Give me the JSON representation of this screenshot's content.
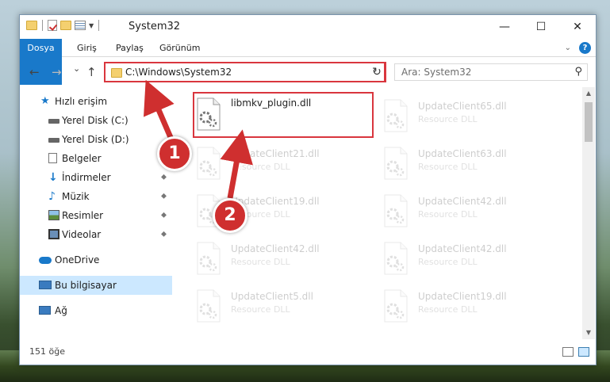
{
  "window": {
    "title": "System32",
    "buttons": {
      "minimize": "—",
      "maximize": "☐",
      "close": "✕"
    }
  },
  "ribbon": {
    "tabs": [
      "Dosya",
      "Giriş",
      "Paylaş",
      "Görünüm"
    ],
    "expand_icon": "chevron-down-icon",
    "help": "?"
  },
  "nav": {
    "back": "←",
    "forward": "→",
    "recent": "⌄",
    "up": "↑"
  },
  "address": {
    "path": "C:\\Windows\\System32",
    "dropdown": "⌄",
    "refresh": "↻"
  },
  "search": {
    "placeholder": "Ara: System32",
    "icon": "⚲"
  },
  "sidebar": {
    "items": [
      {
        "label": "Hızlı erişim",
        "icon": "star-icon",
        "pinned": false
      },
      {
        "label": "Yerel Disk (C:)",
        "icon": "drive-icon",
        "pinned": false
      },
      {
        "label": "Yerel Disk (D:)",
        "icon": "drive-icon",
        "pinned": false
      },
      {
        "label": "Belgeler",
        "icon": "documents-icon",
        "pinned": true
      },
      {
        "label": "İndirmeler",
        "icon": "downloads-icon",
        "pinned": true
      },
      {
        "label": "Müzik",
        "icon": "music-icon",
        "pinned": true
      },
      {
        "label": "Resimler",
        "icon": "pictures-icon",
        "pinned": true
      },
      {
        "label": "Videolar",
        "icon": "videos-icon",
        "pinned": true
      },
      {
        "label": "OneDrive",
        "icon": "cloud-icon",
        "pinned": false
      },
      {
        "label": "Bu bilgisayar",
        "icon": "computer-icon",
        "pinned": false
      },
      {
        "label": "Ağ",
        "icon": "network-icon",
        "pinned": false
      }
    ],
    "pin_glyph": "📌"
  },
  "files": {
    "highlighted": {
      "name": "libmkv_plugin.dll",
      "desc": ""
    },
    "left_column": [
      {
        "name": "UpdateClient21.dll",
        "desc": "Resource DLL"
      },
      {
        "name": "UpdateClient19.dll",
        "desc": "Resource DLL"
      },
      {
        "name": "UpdateClient42.dll",
        "desc": "Resource DLL"
      },
      {
        "name": "UpdateClient5.dll",
        "desc": "Resource DLL"
      }
    ],
    "right_column": [
      {
        "name": "UpdateClient65.dll",
        "desc": "Resource DLL"
      },
      {
        "name": "UpdateClient63.dll",
        "desc": "Resource DLL"
      },
      {
        "name": "UpdateClient42.dll",
        "desc": "Resource DLL"
      },
      {
        "name": "UpdateClient42.dll",
        "desc": "Resource DLL"
      },
      {
        "name": "UpdateClient19.dll",
        "desc": "Resource DLL"
      }
    ]
  },
  "status": {
    "count": "151 öğe"
  },
  "callouts": [
    "1",
    "2"
  ],
  "colors": {
    "accent": "#1979ca",
    "highlight": "#d9363e",
    "callout": "#cf2f2f",
    "selected": "#cce8ff"
  }
}
